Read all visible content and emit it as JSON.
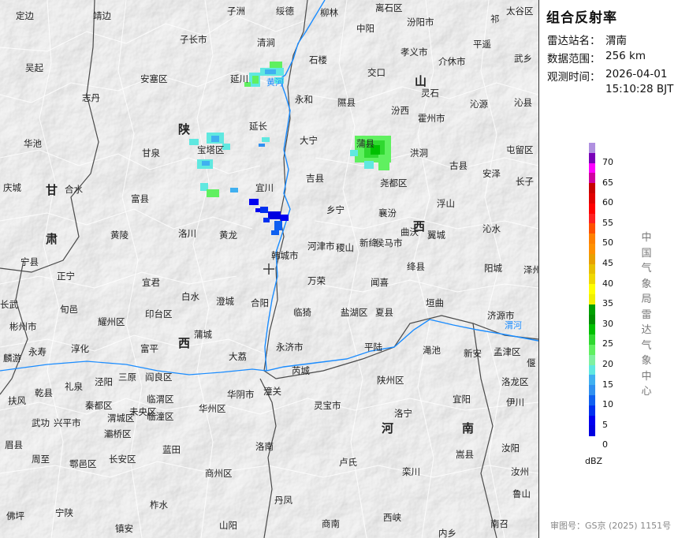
{
  "panel": {
    "title": "组合反射率",
    "station_label": "雷达站名：",
    "station_value": "渭南",
    "range_label": "数据范围：",
    "range_value": "256 km",
    "time_label": "观测时间：",
    "time_date": "2026-04-01",
    "time_clock": "15:10:28 BJT",
    "agency": "中国气象局雷达气象中心",
    "approval": "审图号：GS京 (2025) 1151号"
  },
  "legend": {
    "unit": "dBZ",
    "entries": [
      {
        "label": "70",
        "color": "#b090e0"
      },
      {
        "label": "",
        "color": "#7a00b8"
      },
      {
        "label": "65",
        "color": "#ff00ff"
      },
      {
        "label": "",
        "color": "#d000a0"
      },
      {
        "label": "60",
        "color": "#c80000"
      },
      {
        "label": "",
        "color": "#e00000"
      },
      {
        "label": "55",
        "color": "#ff0000"
      },
      {
        "label": "",
        "color": "#ff2020"
      },
      {
        "label": "50",
        "color": "#ff5000"
      },
      {
        "label": "",
        "color": "#ff8000"
      },
      {
        "label": "45",
        "color": "#ff9000"
      },
      {
        "label": "",
        "color": "#e8a000"
      },
      {
        "label": "40",
        "color": "#e8c000"
      },
      {
        "label": "",
        "color": "#f0d800"
      },
      {
        "label": "35",
        "color": "#ffff00"
      },
      {
        "label": "",
        "color": "#f0f000"
      },
      {
        "label": "30",
        "color": "#00a000"
      },
      {
        "label": "",
        "color": "#009000"
      },
      {
        "label": "25",
        "color": "#00c000"
      },
      {
        "label": "",
        "color": "#30d830"
      },
      {
        "label": "20",
        "color": "#60f060"
      },
      {
        "label": "",
        "color": "#80f0a0"
      },
      {
        "label": "15",
        "color": "#60e8e0"
      },
      {
        "label": "",
        "color": "#40b0f0"
      },
      {
        "label": "10",
        "color": "#3090f0"
      },
      {
        "label": "",
        "color": "#1060f0"
      },
      {
        "label": "5",
        "color": "#0030f0"
      },
      {
        "label": "",
        "color": "#0000f0"
      },
      {
        "label": "0",
        "color": "#0000e0"
      }
    ]
  },
  "map": {
    "radar_station": "渭南",
    "provinces": [
      "山",
      "西",
      "陕",
      "西",
      "甘",
      "肃",
      "河",
      "南"
    ],
    "rivers": [
      "黄河",
      "渭河"
    ],
    "places": [
      {
        "name": "定边"
      },
      {
        "name": "靖边"
      },
      {
        "name": "子洲"
      },
      {
        "name": "绥德"
      },
      {
        "name": "柳林"
      },
      {
        "name": "离石区"
      },
      {
        "name": "汾阳市"
      },
      {
        "name": "孝义市"
      },
      {
        "name": "平遥"
      },
      {
        "name": "介休市"
      },
      {
        "name": "祁"
      },
      {
        "name": "太谷区"
      },
      {
        "name": "中阳"
      },
      {
        "name": "子长市"
      },
      {
        "name": "清涧"
      },
      {
        "name": "石楼"
      },
      {
        "name": "交口"
      },
      {
        "name": "灵石"
      },
      {
        "name": "武乡"
      },
      {
        "name": "吴起"
      },
      {
        "name": "安塞区"
      },
      {
        "name": "延川"
      },
      {
        "name": "永和"
      },
      {
        "name": "隰县"
      },
      {
        "name": "汾西"
      },
      {
        "name": "霍州市"
      },
      {
        "name": "沁源"
      },
      {
        "name": "沁县"
      },
      {
        "name": "志丹"
      },
      {
        "name": "延长"
      },
      {
        "name": "大宁"
      },
      {
        "name": "蒲县"
      },
      {
        "name": "洪洞"
      },
      {
        "name": "屯留区"
      },
      {
        "name": "华池"
      },
      {
        "name": "甘泉"
      },
      {
        "name": "宝塔区"
      },
      {
        "name": "吉县"
      },
      {
        "name": "尧都区"
      },
      {
        "name": "古县"
      },
      {
        "name": "安泽"
      },
      {
        "name": "长子"
      },
      {
        "name": "庆城"
      },
      {
        "name": "合水"
      },
      {
        "name": "富县"
      },
      {
        "name": "宜川"
      },
      {
        "name": "乡宁"
      },
      {
        "name": "襄汾"
      },
      {
        "name": "浮山"
      },
      {
        "name": "宁县"
      },
      {
        "name": "黄陵"
      },
      {
        "name": "洛川"
      },
      {
        "name": "黄龙"
      },
      {
        "name": "河津市"
      },
      {
        "name": "稷山"
      },
      {
        "name": "新绛"
      },
      {
        "name": "侯马市"
      },
      {
        "name": "曲沃"
      },
      {
        "name": "翼城"
      },
      {
        "name": "沁水"
      },
      {
        "name": "正宁"
      },
      {
        "name": "韩城市"
      },
      {
        "name": "绛县"
      },
      {
        "name": "阳城"
      },
      {
        "name": "泽州"
      },
      {
        "name": "宜君"
      },
      {
        "name": "万荣"
      },
      {
        "name": "闻喜"
      },
      {
        "name": "旬邑"
      },
      {
        "name": "白水"
      },
      {
        "name": "澄城"
      },
      {
        "name": "合阳"
      },
      {
        "name": "临猗"
      },
      {
        "name": "盐湖区"
      },
      {
        "name": "夏县"
      },
      {
        "name": "垣曲"
      },
      {
        "name": "济源市"
      },
      {
        "name": "长武"
      },
      {
        "name": "彬州市"
      },
      {
        "name": "耀州区"
      },
      {
        "name": "印台区"
      },
      {
        "name": "蒲城"
      },
      {
        "name": "大荔"
      },
      {
        "name": "永济市"
      },
      {
        "name": "平陆"
      },
      {
        "name": "渑池"
      },
      {
        "name": "新安"
      },
      {
        "name": "孟津区"
      },
      {
        "name": "偃"
      },
      {
        "name": "麟游"
      },
      {
        "name": "永寿"
      },
      {
        "name": "淳化"
      },
      {
        "name": "富平"
      },
      {
        "name": "芮城"
      },
      {
        "name": "陕州区"
      },
      {
        "name": "宜阳"
      },
      {
        "name": "洛龙区"
      },
      {
        "name": "扶风"
      },
      {
        "name": "乾县"
      },
      {
        "name": "礼泉"
      },
      {
        "name": "泾阳"
      },
      {
        "name": "三原"
      },
      {
        "name": "阎良区"
      },
      {
        "name": "临渭区"
      },
      {
        "name": "华阴市"
      },
      {
        "name": "潼关"
      },
      {
        "name": "灵宝市"
      },
      {
        "name": "伊川"
      },
      {
        "name": "武功"
      },
      {
        "name": "兴平市"
      },
      {
        "name": "秦都区"
      },
      {
        "name": "渭城区"
      },
      {
        "name": "未央区"
      },
      {
        "name": "灞桥区"
      },
      {
        "name": "临潼区"
      },
      {
        "name": "华州区"
      },
      {
        "name": "洛宁"
      },
      {
        "name": "周至"
      },
      {
        "name": "鄠邑区"
      },
      {
        "name": "长安区"
      },
      {
        "name": "蓝田"
      },
      {
        "name": "洛南"
      },
      {
        "name": "卢氏"
      },
      {
        "name": "栾川"
      },
      {
        "name": "嵩县"
      },
      {
        "name": "汝阳"
      },
      {
        "name": "汝州"
      },
      {
        "name": "眉县"
      },
      {
        "name": "商州区"
      },
      {
        "name": "柞水"
      },
      {
        "name": "丹凤"
      },
      {
        "name": "鲁山"
      },
      {
        "name": "佛坪"
      },
      {
        "name": "宁陕"
      },
      {
        "name": "镇安"
      },
      {
        "name": "山阳"
      },
      {
        "name": "商南"
      },
      {
        "name": "西峡"
      },
      {
        "name": "内乡"
      },
      {
        "name": "南召"
      }
    ]
  }
}
